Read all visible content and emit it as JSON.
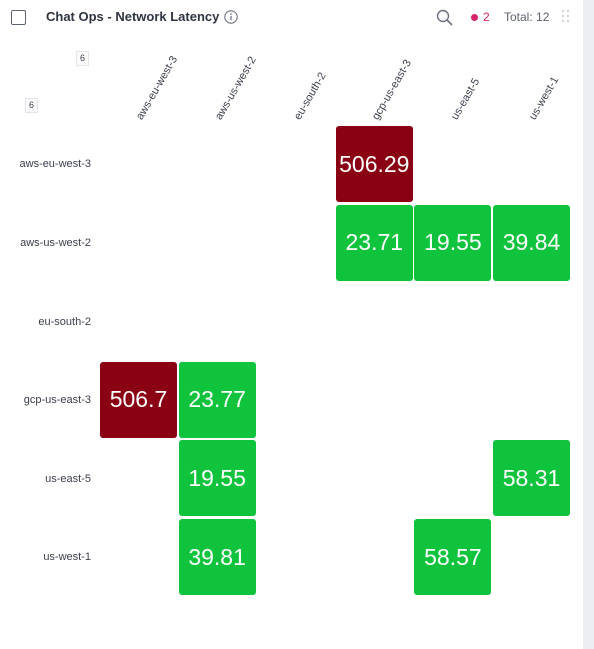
{
  "header": {
    "title": "Chat Ops - Network Latency",
    "alert_count": "2",
    "total": "Total: 12"
  },
  "matrix": {
    "corner_col_badge": "6",
    "corner_row_badge": "6",
    "columns": [
      "aws-eu-west-3",
      "aws-us-west-2",
      "eu-south-2",
      "gcp-us-east-3",
      "us-east-5",
      "us-west-1"
    ],
    "rows": [
      "aws-eu-west-3",
      "aws-us-west-2",
      "eu-south-2",
      "gcp-us-east-3",
      "us-east-5",
      "us-west-1"
    ],
    "cells": [
      {
        "row": "aws-eu-west-3",
        "col": "gcp-us-east-3",
        "value": "506.29",
        "status": "bad"
      },
      {
        "row": "aws-us-west-2",
        "col": "gcp-us-east-3",
        "value": "23.71",
        "status": "ok"
      },
      {
        "row": "aws-us-west-2",
        "col": "us-east-5",
        "value": "19.55",
        "status": "ok"
      },
      {
        "row": "aws-us-west-2",
        "col": "us-west-1",
        "value": "39.84",
        "status": "ok"
      },
      {
        "row": "gcp-us-east-3",
        "col": "aws-eu-west-3",
        "value": "506.7",
        "status": "bad"
      },
      {
        "row": "gcp-us-east-3",
        "col": "aws-us-west-2",
        "value": "23.77",
        "status": "ok"
      },
      {
        "row": "us-east-5",
        "col": "aws-us-west-2",
        "value": "19.55",
        "status": "ok"
      },
      {
        "row": "us-east-5",
        "col": "us-west-1",
        "value": "58.31",
        "status": "ok"
      },
      {
        "row": "us-west-1",
        "col": "aws-us-west-2",
        "value": "39.81",
        "status": "ok"
      },
      {
        "row": "us-west-1",
        "col": "us-east-5",
        "value": "58.57",
        "status": "ok"
      }
    ]
  },
  "colors": {
    "ok": "#0fc43c",
    "bad": "#8a0114",
    "alert": "#d6246b"
  },
  "icons": {
    "info": "info-icon",
    "search": "search-icon",
    "drag": "drag-handle-icon"
  }
}
